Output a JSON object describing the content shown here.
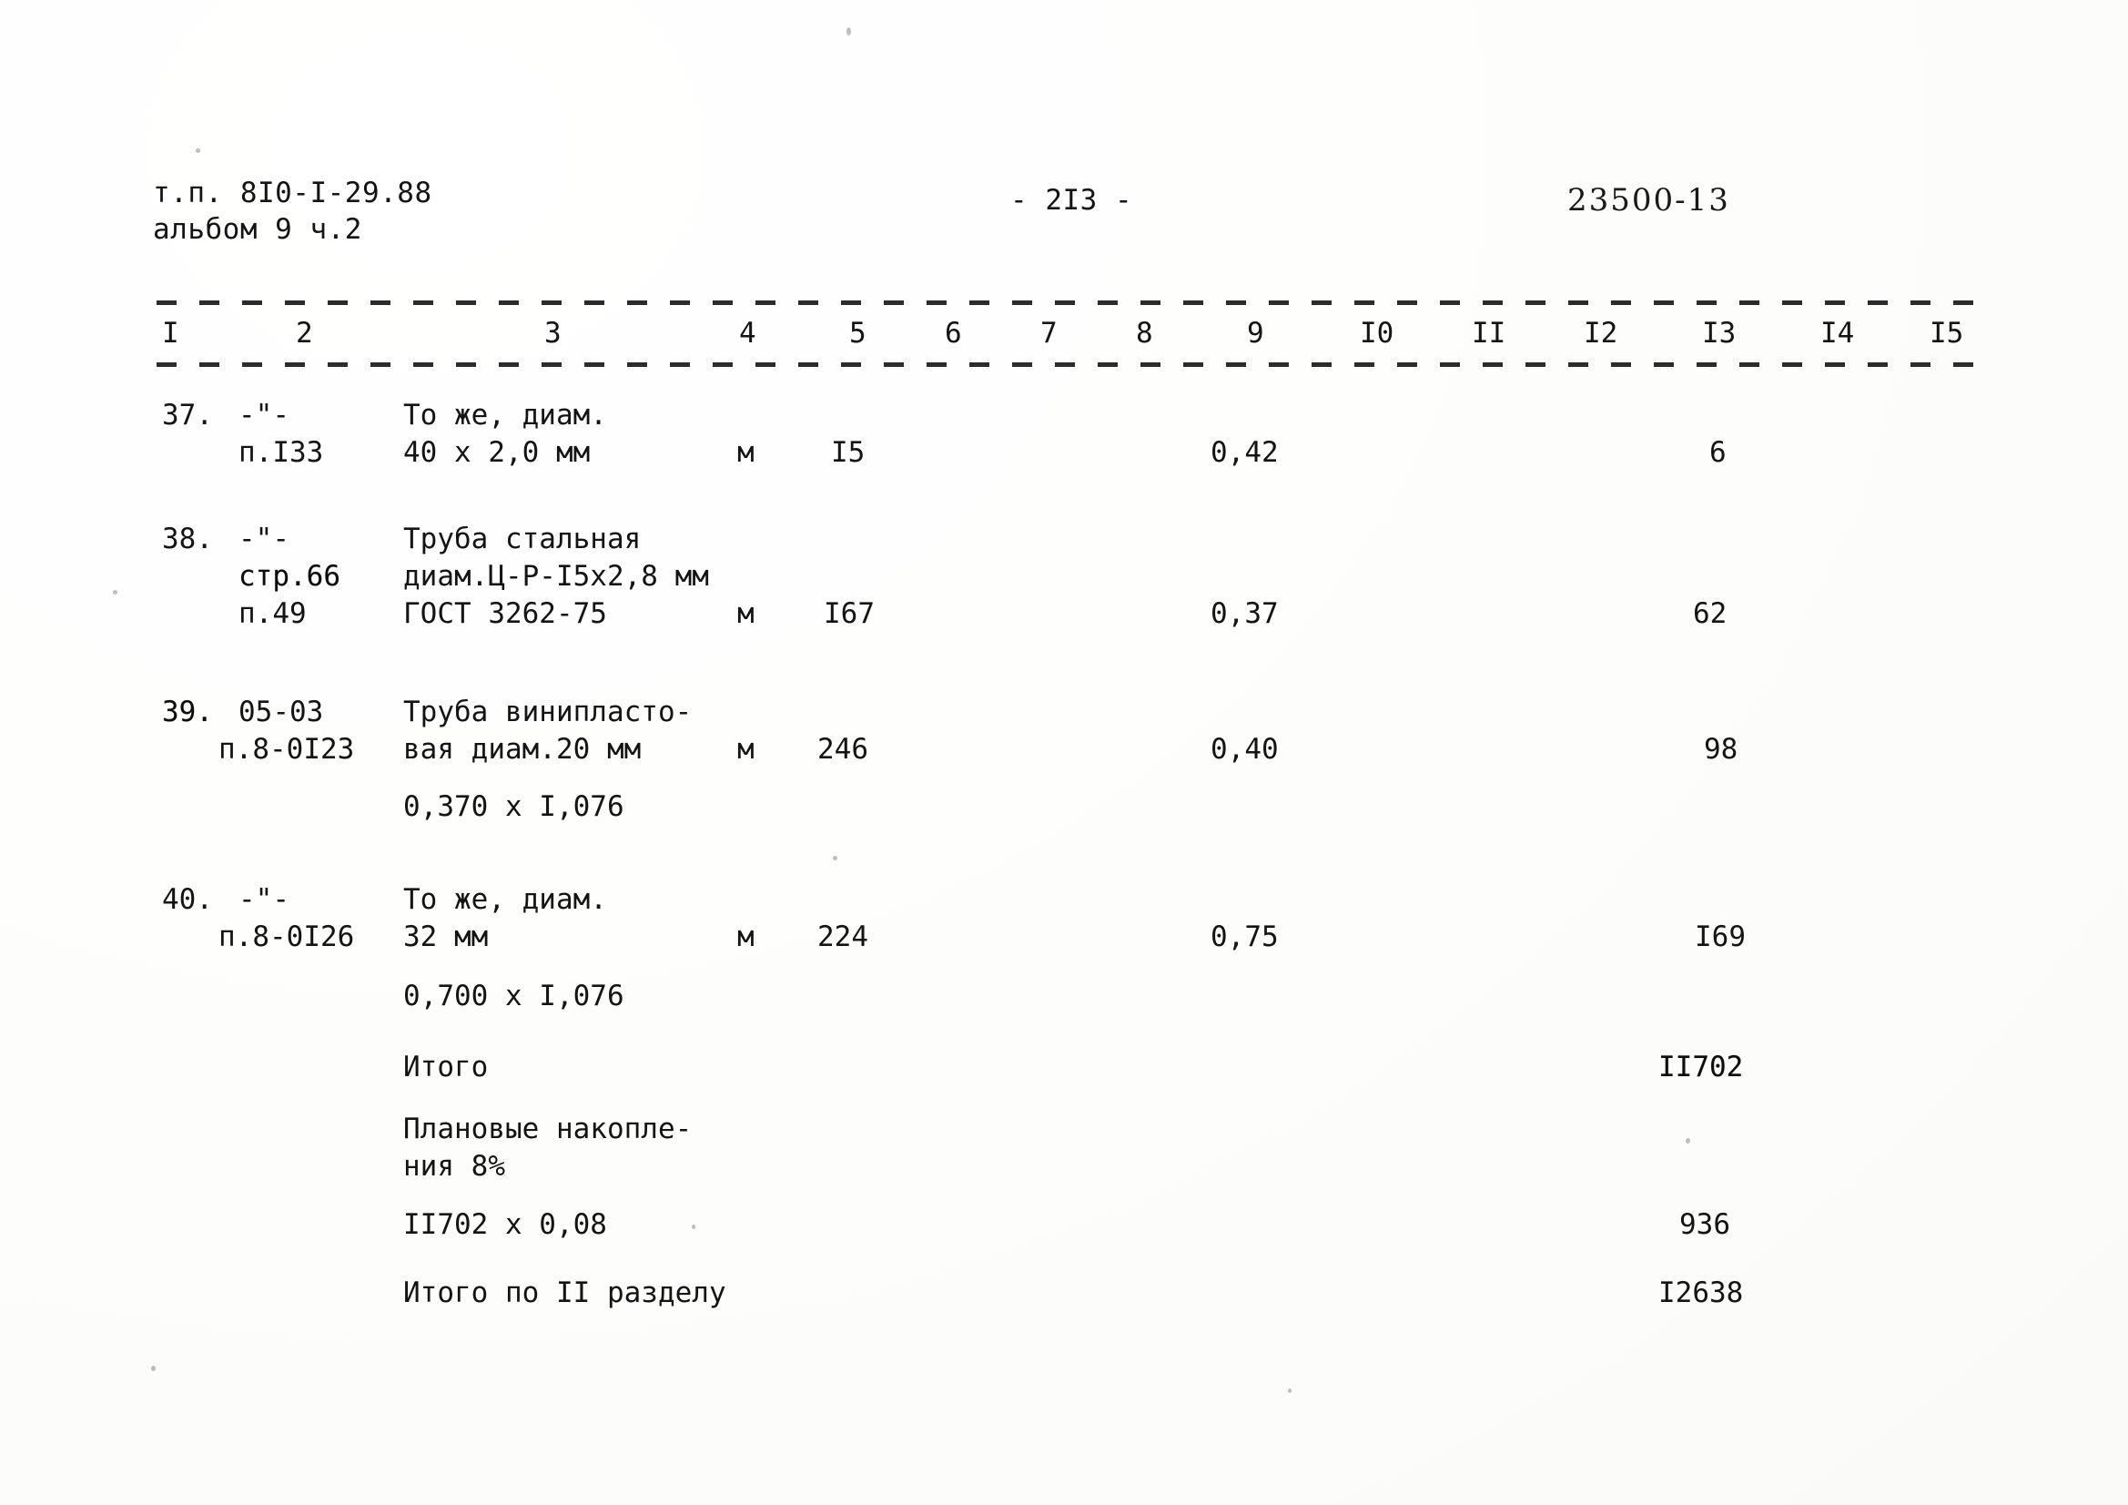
{
  "header": {
    "doc_code_line1": "т.п. 8I0-I-29.88",
    "doc_code_line2": "альбом 9 ч.2",
    "page_marker": "- 2I3 -",
    "stamp_number": "23500-13"
  },
  "table": {
    "column_numbers": [
      "I",
      "2",
      "3",
      "4",
      "5",
      "6",
      "7",
      "8",
      "9",
      "I0",
      "II",
      "I2",
      "I3",
      "I4",
      "I5"
    ],
    "rows": [
      {
        "num": "37.",
        "code_lines": [
          "-\"-",
          "п.I33"
        ],
        "desc_lines": [
          "То же, диам.",
          "40 х 2,0 мм"
        ],
        "unit": "м",
        "qty": "I5",
        "col9": "0,42",
        "col13": "6",
        "extra_line": ""
      },
      {
        "num": "38.",
        "code_lines": [
          "-\"-",
          "стр.66",
          "п.49"
        ],
        "desc_lines": [
          "Труба стальная",
          "диам.Ц-Р-I5х2,8 мм",
          "ГОСТ 3262-75"
        ],
        "unit": "м",
        "qty": "I67",
        "col9": "0,37",
        "col13": "62",
        "extra_line": ""
      },
      {
        "num": "39.",
        "code_lines": [
          "05-03",
          "п.8-0I23"
        ],
        "desc_lines": [
          "Труба винипласто-",
          "вая диам.20 мм"
        ],
        "unit": "м",
        "qty": "246",
        "col9": "0,40",
        "col13": "98",
        "extra_line": "0,370 х I,076"
      },
      {
        "num": "40.",
        "code_lines": [
          "-\"-",
          "п.8-0I26"
        ],
        "desc_lines": [
          "То же, диам.",
          "32 мм"
        ],
        "unit": "м",
        "qty": "224",
        "col9": "0,75",
        "col13": "I69",
        "extra_line": "0,700 х I,076"
      }
    ],
    "summary": [
      {
        "label_lines": [
          "Итого"
        ],
        "value": "II702"
      },
      {
        "label_lines": [
          "Плановые накопле-",
          "ния 8%"
        ],
        "value": ""
      },
      {
        "label_lines": [
          "II702 х 0,08"
        ],
        "value": "936"
      },
      {
        "label_lines": [
          "Итого по II разделу"
        ],
        "value": "I2638"
      }
    ]
  }
}
